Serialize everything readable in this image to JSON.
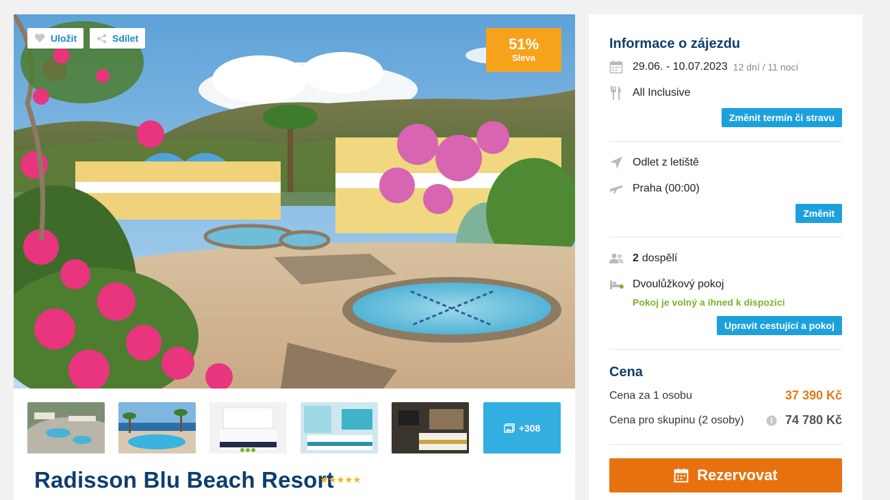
{
  "hero": {
    "save_label": "Uložit",
    "share_label": "Sdílet",
    "discount_percent": "51%",
    "discount_label": "Sleva"
  },
  "gallery": {
    "more_count": "+308",
    "thumbnails": [
      "aerial-resort",
      "pool-sea-view",
      "white-bedroom",
      "turquoise-room",
      "dark-room"
    ]
  },
  "hotel": {
    "name": "Radisson Blu Beach Resort",
    "stars": 5
  },
  "trip": {
    "title": "Informace o zájezdu",
    "dates": "29.06. - 10.07.2023",
    "duration": "12 dní / 11 nocí",
    "board": "All Inclusive",
    "change_button": "Změnit termín či stravu"
  },
  "flight": {
    "label": "Odlet z letiště",
    "airport": "Praha (00:00)",
    "change_button": "Změnit"
  },
  "travelers": {
    "count": "2",
    "count_label": "dospělí",
    "room": "Dvoulůžkový pokoj",
    "availability": "Pokoj je volný a ihned k dispozici",
    "edit_button": "Upravit cestující a pokoj"
  },
  "price": {
    "title": "Cena",
    "per_person_label": "Cena za 1 osobu",
    "per_person_value": "37 390 Kč",
    "group_label": "Cena pro skupinu (2 osoby)",
    "group_value": "74 780 Kč",
    "book_button": "Rezervovat"
  },
  "colors": {
    "brand_blue": "#1da1dd",
    "title_navy": "#0d3f6e",
    "discount_orange": "#f7a21b",
    "book_orange": "#e8710f",
    "available_green": "#7db32a"
  }
}
